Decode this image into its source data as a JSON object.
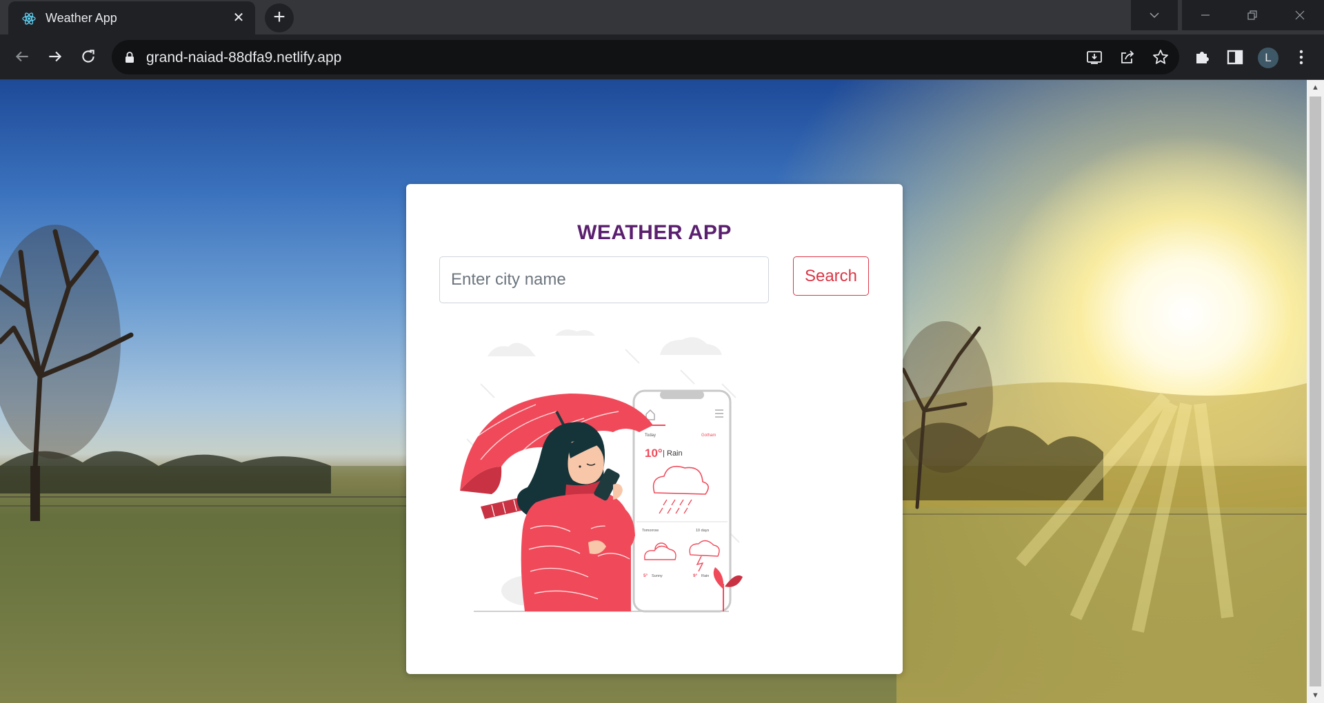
{
  "browser": {
    "tab": {
      "title": "Weather App",
      "favicon": "react-icon",
      "close_glyph": "✕"
    },
    "new_tab_glyph": "+",
    "window_controls": [
      "chevron-down-icon",
      "minimize-icon",
      "restore-icon",
      "close-icon"
    ],
    "address_bar": {
      "url": "grand-naiad-88dfa9.netlify.app",
      "secure_icon": "lock-icon"
    },
    "address_actions": [
      "install-icon",
      "share-icon",
      "bookmark-star-icon"
    ],
    "toolbar_actions": [
      "extensions-puzzle-icon",
      "side-panel-icon",
      "profile-avatar",
      "more-menu-icon"
    ],
    "profile_initial": "L"
  },
  "page": {
    "title": "WEATHER APP",
    "search": {
      "placeholder": "Enter city name",
      "value": "",
      "button_label": "Search"
    },
    "illustration": {
      "type": "woman-with-umbrella-and-phone",
      "phone_screen": {
        "today_label": "Today",
        "location_label": "Gotham",
        "temp": "10°",
        "condition": "Rain",
        "tomorrow_label": "Tomorrow",
        "range_label": "10 days",
        "tomorrow_temp": "5°",
        "tomorrow_condition": "Sunny",
        "range_temp": "9°",
        "range_condition": "Rain"
      }
    }
  },
  "colors": {
    "title": "#5a1f6e",
    "search_button": "#dc3545",
    "umbrella": "#f04a5a",
    "browser_frame": "#202124"
  }
}
